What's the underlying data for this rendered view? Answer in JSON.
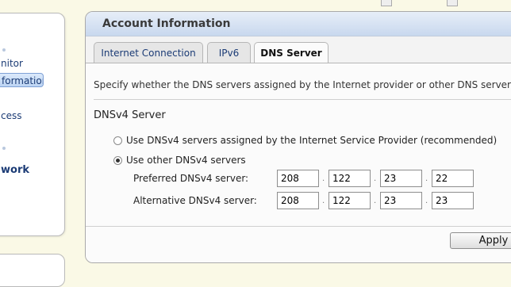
{
  "sidebar": {
    "items": [
      {
        "label": "nitor"
      },
      {
        "label": "formation"
      },
      {
        "label": "cess"
      },
      {
        "label": "work"
      }
    ]
  },
  "panel": {
    "title": "Account Information",
    "tabs": [
      {
        "label": "Internet Connection"
      },
      {
        "label": "IPv6"
      },
      {
        "label": "DNS Server"
      }
    ],
    "description": "Specify whether the DNS servers assigned by the Internet provider or other DNS servers sho",
    "section_title": "DNSv4 Server",
    "options": [
      {
        "label": "Use DNSv4 servers assigned by the Internet Service Provider (recommended)",
        "selected": false
      },
      {
        "label": "Use other DNSv4 servers",
        "selected": true
      }
    ],
    "preferred": {
      "label": "Preferred DNSv4 server:",
      "octets": [
        "208",
        "122",
        "23",
        "22"
      ]
    },
    "alternative": {
      "label": "Alternative DNSv4 server:",
      "octets": [
        "208",
        "122",
        "23",
        "23"
      ]
    },
    "apply_label": "Apply"
  }
}
